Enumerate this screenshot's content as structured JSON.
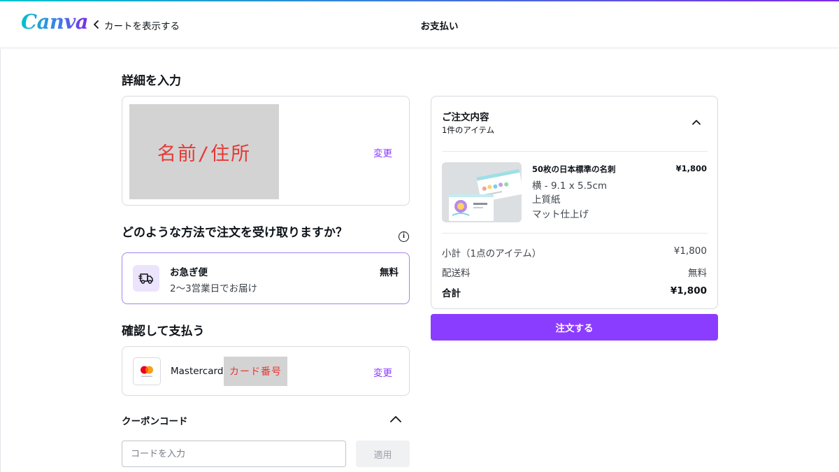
{
  "header": {
    "logo_text": "Canva",
    "back_label": "カートを表示する",
    "page_title": "お支払い",
    "brand_color": "#8b3dff"
  },
  "details": {
    "heading": "詳細を入力",
    "redacted_label": "名前/住所",
    "change_label": "変更"
  },
  "shipping": {
    "heading": "どのような方法で注文を受け取りますか？",
    "method_name": "お急ぎ便",
    "method_detail": "2〜3営業日でお届け",
    "price": "無料",
    "icon": "truck-icon"
  },
  "payment": {
    "heading": "確認して支払う",
    "card_brand": "Mastercard",
    "redacted_label": "カード番号",
    "change_label": "変更",
    "icon": "mastercard-icon"
  },
  "coupon": {
    "heading": "クーポンコード",
    "placeholder": "コードを入力",
    "value": "",
    "apply_label": "適用"
  },
  "order": {
    "title": "ご注文内容",
    "item_count": "1件のアイテム",
    "item": {
      "name": "50枚の日本標準の名刺",
      "price": "¥1,800",
      "options": [
        "横 - 9.1 x 5.5cm",
        "上質紙",
        "マット仕上げ"
      ]
    },
    "subtotal_label": "小計（1点のアイテム）",
    "subtotal_value": "¥1,800",
    "shipping_label": "配送料",
    "shipping_value": "無料",
    "total_label": "合計",
    "total_value": "¥1,800",
    "submit_label": "注文する"
  }
}
